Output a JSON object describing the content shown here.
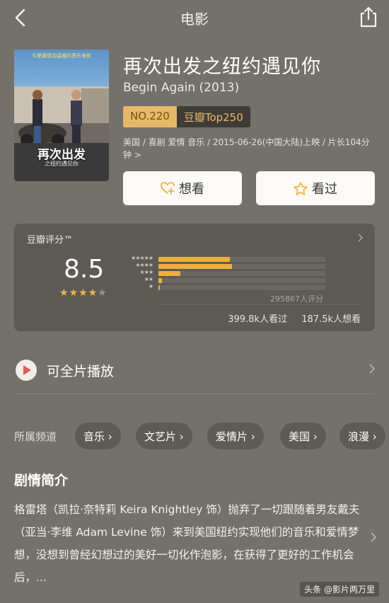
{
  "nav": {
    "title": "电影"
  },
  "poster": {
    "tagline": "今夏最感动温暖的音乐电影",
    "title": "再次出发",
    "subtitle": "之纽约遇见你"
  },
  "movie": {
    "title": "再次出发之纽约遇见你",
    "title_en": "Begin Again (2013)",
    "rank_no": "NO.220",
    "rank_list": "豆瓣Top250",
    "meta": "美国 / 喜剧 爱情 音乐 / 2015-06-26(中国大陆)上映 / 片长104分钟 >"
  },
  "actions": {
    "want": "想看",
    "seen": "看过"
  },
  "rating": {
    "label": "豆瓣评分™",
    "score": "8.5",
    "stars_filled": 4,
    "stars_total": 5,
    "distribution": [
      {
        "stars": "★★★★★",
        "fraction": 0.43
      },
      {
        "stars": "★★★★",
        "fraction": 0.44
      },
      {
        "stars": "★★★",
        "fraction": 0.13
      },
      {
        "stars": "★★",
        "fraction": 0.02
      },
      {
        "stars": "★",
        "fraction": 0.01
      }
    ],
    "count": "295867人评分",
    "seen": "399.8k人看过",
    "want": "187.5k人想看"
  },
  "play": {
    "label": "可全片播放"
  },
  "channels": {
    "label": "所属频道",
    "items": [
      "音乐 ›",
      "文艺片 ›",
      "爱情片 ›",
      "美国 ›",
      "浪漫 ›"
    ]
  },
  "synopsis": {
    "title": "剧情简介",
    "text": "格雷塔（凯拉·奈特莉 Keira Knightley 饰）抛弃了一切跟随着男友戴夫（亚当·李维 Adam Levine 饰）来到美国纽约实现他们的音乐和爱情梦想，没想到曾经幻想过的美好一切化作泡影，在获得了更好的工作机会后，..."
  },
  "watermark": "头条 @影片两万里",
  "colors": {
    "accent": "#f0ae3c",
    "background": "#74706a",
    "card": "#5d5a55"
  }
}
